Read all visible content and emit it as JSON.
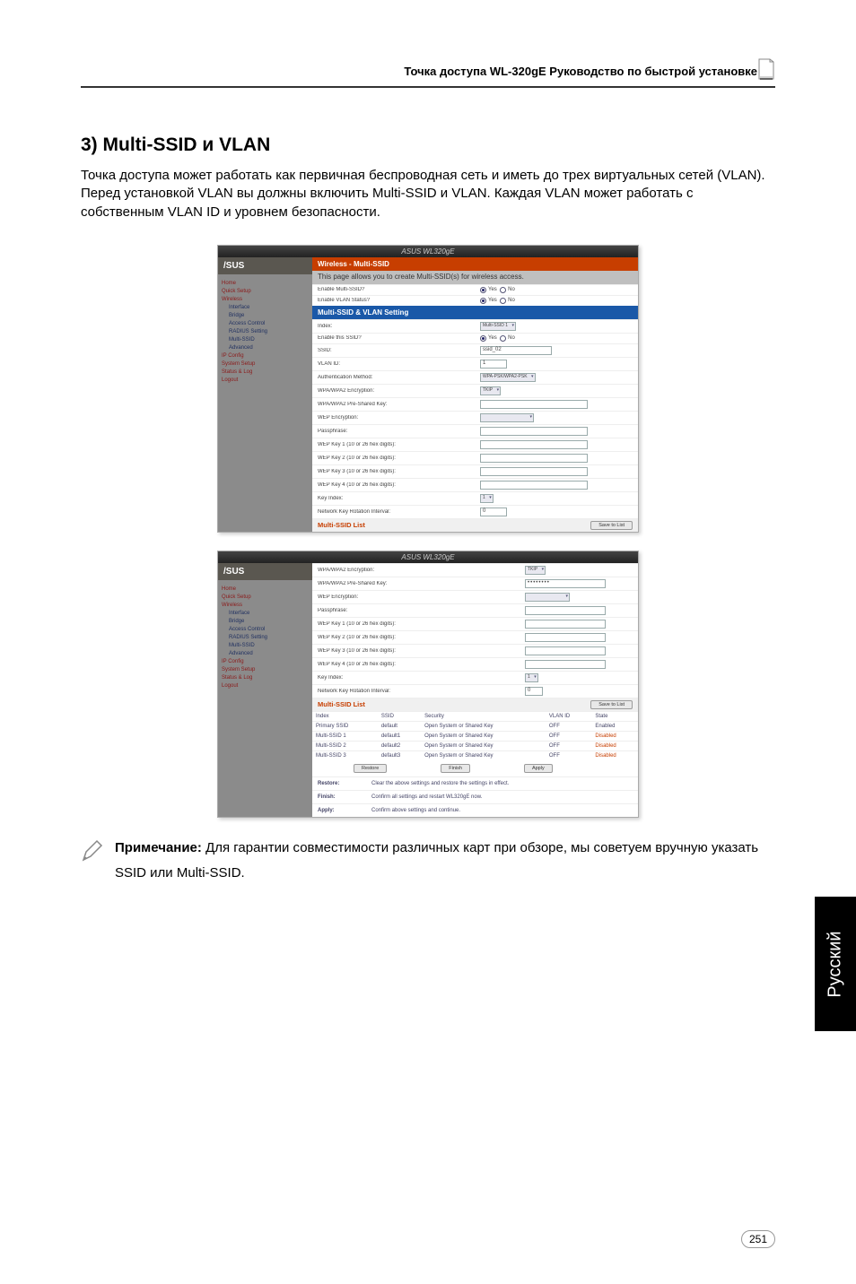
{
  "header": {
    "product_doc_title": "Точка доступа WL-320gE Руководство по быстрой установке"
  },
  "section": {
    "heading": "3) Multi-SSID и VLAN",
    "intro": "Точка доступа может работать как первичная беспроводная сеть и иметь до трех виртуальных сетей (VLAN). Перед установкой VLAN вы должны включить Multi-SSID и VLAN. Каждая VLAN может работать с собственным VLAN ID и уровнем безопасности."
  },
  "screenshot_common": {
    "titlebar": "ASUS WL320gE",
    "logo": "/SUS",
    "nav": {
      "home": "Home",
      "quick_setup": "Quick Setup",
      "wireless": "Wireless",
      "interface": "Interface",
      "bridge": "Bridge",
      "access_control": "Access Control",
      "radius_setting": "RADIUS Setting",
      "multi_ssid": "Multi-SSID",
      "advanced": "Advanced",
      "ip_config": "IP Config",
      "system_setup": "System Setup",
      "status_log": "Status & Log",
      "logout": "Logout"
    }
  },
  "screenshot_a": {
    "band_main": "Wireless - Multi-SSID",
    "band_desc": "This page allows you to create Multi-SSID(s) for wireless access.",
    "rows": {
      "enable_multi_ssid": "Enable Multi-SSID?",
      "enable_vlan": "Enable VLAN Status?",
      "yes": "Yes",
      "no": "No"
    },
    "band_settings": "Multi-SSID & VLAN Setting",
    "settings_rows": {
      "index": "Index:",
      "enable_this": "Enable this SSID?",
      "ssid": "SSID:",
      "vlan_id": "VLAN ID:",
      "auth": "Authentication Method:",
      "wpa_enc": "WPA/WPA2 Encryption:",
      "wpa_psk": "WPA/WPA2 Pre-Shared Key:",
      "wep_enc": "WEP Encryption:",
      "passphrase": "Passphrase:",
      "wep1": "WEP Key 1 (10 or 26 hex digits):",
      "wep2": "WEP Key 2 (10 or 26 hex digits):",
      "wep3": "WEP Key 3 (10 or 26 hex digits):",
      "wep4": "WEP Key 4 (10 or 26 hex digits):",
      "key_index": "Key Index:",
      "rekey": "Network Key Rotation Interval:"
    },
    "values": {
      "index_sel": "Multi-SSID 1",
      "ssid_val": "ssid_02",
      "vlan_val": "1",
      "auth_sel": "WPA-PSK/WPA2-PSK",
      "wpa_enc_sel": "TKIP",
      "key_index_sel": "1",
      "rekey_val": "0"
    },
    "band_list": "Multi-SSID List",
    "save_btn": "Save to List"
  },
  "screenshot_b": {
    "rows": {
      "wpa_enc": "WPA/WPA2 Encryption:",
      "wpa_psk": "WPA/WPA2 Pre-Shared Key:",
      "wep_enc": "WEP Encryption:",
      "passphrase": "Passphrase:",
      "wep1": "WEP Key 1 (10 or 26 hex digits):",
      "wep2": "WEP Key 2 (10 or 26 hex digits):",
      "wep3": "WEP Key 3 (10 or 26 hex digits):",
      "wep4": "WEP Key 4 (10 or 26 hex digits):",
      "key_index": "Key Index:",
      "rekey": "Network Key Rotation Interval:"
    },
    "values": {
      "wpa_enc_sel": "TKIP",
      "wpa_psk_val": "••••••••",
      "key_index_sel": "1",
      "rekey_val": "0"
    },
    "band_list": "Multi-SSID List",
    "save_btn": "Save to List",
    "table": {
      "headers": {
        "index": "Index",
        "ssid": "SSID",
        "security": "Security",
        "vlan_id": "VLAN ID",
        "state": "State"
      },
      "rows": [
        {
          "index": "Primary SSID",
          "ssid": "default",
          "security": "Open System or Shared Key",
          "vlan": "OFF",
          "state": "Enabled"
        },
        {
          "index": "Multi-SSID 1",
          "ssid": "default1",
          "security": "Open System or Shared Key",
          "vlan": "OFF",
          "state": "Disabled"
        },
        {
          "index": "Multi-SSID 2",
          "ssid": "default2",
          "security": "Open System or Shared Key",
          "vlan": "OFF",
          "state": "Disabled"
        },
        {
          "index": "Multi-SSID 3",
          "ssid": "default3",
          "security": "Open System or Shared Key",
          "vlan": "OFF",
          "state": "Disabled"
        }
      ]
    },
    "buttons": {
      "restore": "Restore",
      "finish": "Finish",
      "apply": "Apply"
    },
    "button_labels": {
      "restore": "Restore:",
      "restore_desc": "Clear the above settings and restore the settings in effect.",
      "finish": "Finish:",
      "finish_desc": "Confirm all settings and restart WL320gE now.",
      "apply": "Apply:",
      "apply_desc": "Confirm above settings and continue."
    }
  },
  "note": {
    "label": "Примечание:",
    "text": " Для гарантии совместимости различных карт при обзоре, мы советуем вручную указать SSID или Multi-SSID."
  },
  "side_tab": "Русский",
  "page_number": "251"
}
